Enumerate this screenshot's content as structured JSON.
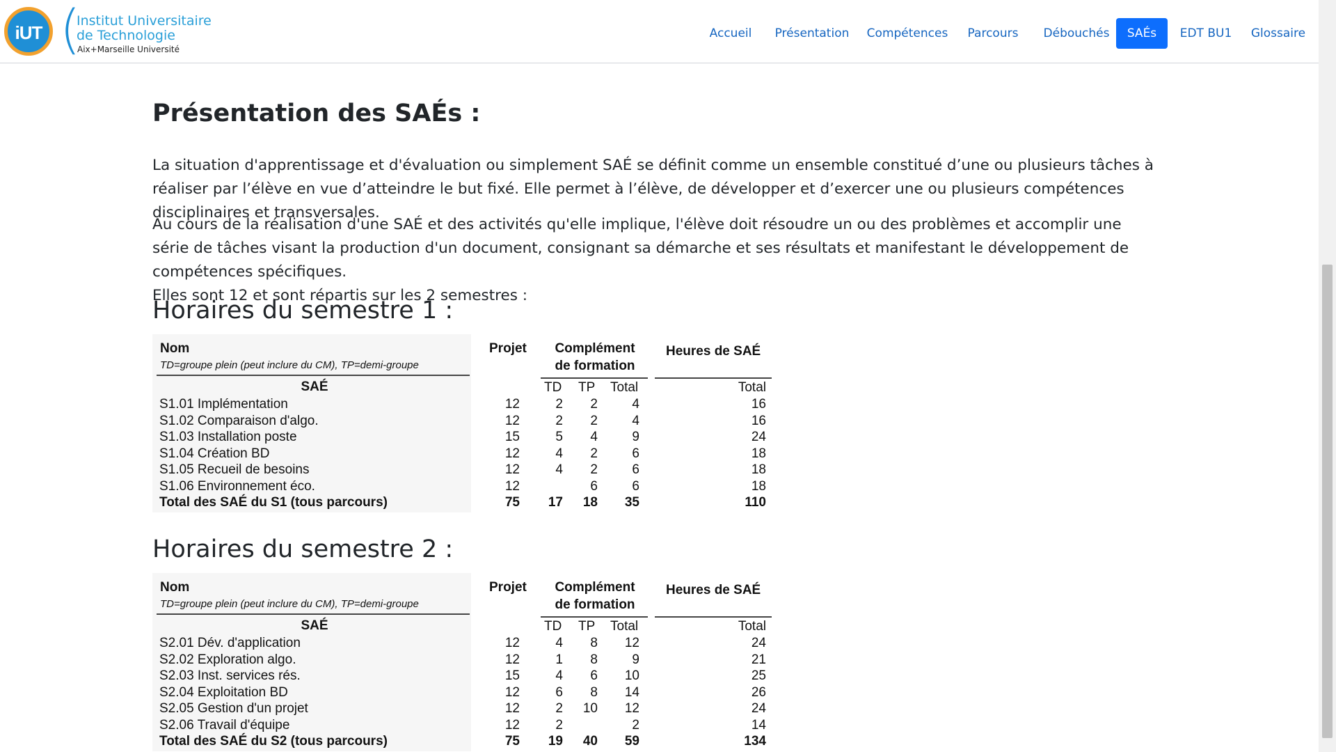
{
  "logo": {
    "badge": "iUT",
    "line1": "Institut Universitaire",
    "line2": "de Technologie",
    "line3": "Aix+Marseille Université"
  },
  "nav": {
    "items": [
      {
        "label": "Accueil"
      },
      {
        "label": "Présentation"
      },
      {
        "label": "Compétences"
      },
      {
        "label": "Parcours"
      },
      {
        "label": "Débouchés"
      },
      {
        "label": "SAÉs"
      },
      {
        "label": "EDT BU1"
      },
      {
        "label": "Glossaire"
      }
    ],
    "active": "SAÉs"
  },
  "content": {
    "title": "Présentation des SAÉs :",
    "paragraph1": "La situation d'apprentissage et d'évaluation ou simplement SAÉ se définit comme un ensemble constitué d’une ou plusieurs tâches à réaliser par l’élève en vue d’atteindre le but fixé. Elle permet à l’élève, de développer et d’exercer une ou plusieurs compétences disciplinaires et transversales.",
    "paragraph2_line1": "Au cours de la réalisation d'une SAÉ et des activités qu'elle implique, l'élève doit résoudre un ou des problèmes et accomplir une série de tâches visant la production d'un document, consignant sa démarche et ses résultats et manifestant le développement de compétences spécifiques.",
    "paragraph2_line2": "Elles sont 12 et sont répartis sur les 2 semestres :"
  },
  "semesters": [
    {
      "heading": "Horaires du semestre 1 :",
      "headers": {
        "nom": "Nom",
        "sub": "TD=groupe plein (peut inclure du CM), TP=demi-groupe",
        "projet": "Projet",
        "comp1": "Complément",
        "comp2": "de formation",
        "heures": "Heures de SAÉ",
        "sae": "SAÉ",
        "td": "TD",
        "tp": "TP",
        "total": "Total",
        "total2": "Total"
      },
      "rows": [
        {
          "name": "S1.01 Implémentation",
          "projet": "12",
          "td": "2",
          "tp": "2",
          "total": "4",
          "heures": "16"
        },
        {
          "name": "S1.02 Comparaison d'algo.",
          "projet": "12",
          "td": "2",
          "tp": "2",
          "total": "4",
          "heures": "16"
        },
        {
          "name": "S1.03 Installation poste",
          "projet": "15",
          "td": "5",
          "tp": "4",
          "total": "9",
          "heures": "24"
        },
        {
          "name": "S1.04 Création BD",
          "projet": "12",
          "td": "4",
          "tp": "2",
          "total": "6",
          "heures": "18"
        },
        {
          "name": "S1.05 Recueil de besoins",
          "projet": "12",
          "td": "4",
          "tp": "2",
          "total": "6",
          "heures": "18"
        },
        {
          "name": "S1.06 Environnement éco.",
          "projet": "12",
          "td": "",
          "tp": "6",
          "total": "6",
          "heures": "18"
        }
      ],
      "total_row": {
        "name": "Total des SAÉ du S1 (tous parcours)",
        "projet": "75",
        "td": "17",
        "tp": "18",
        "total": "35",
        "heures": "110"
      }
    },
    {
      "heading": "Horaires du semestre 2 :",
      "headers": {
        "nom": "Nom",
        "sub": "TD=groupe plein (peut inclure du CM), TP=demi-groupe",
        "projet": "Projet",
        "comp1": "Complément",
        "comp2": "de formation",
        "heures": "Heures de SAÉ",
        "sae": "SAÉ",
        "td": "TD",
        "tp": "TP",
        "total": "Total",
        "total2": "Total"
      },
      "rows": [
        {
          "name": "S2.01 Dév. d'application",
          "projet": "12",
          "td": "4",
          "tp": "8",
          "total": "12",
          "heures": "24"
        },
        {
          "name": "S2.02 Exploration algo.",
          "projet": "12",
          "td": "1",
          "tp": "8",
          "total": "9",
          "heures": "21"
        },
        {
          "name": "S2.03 Inst. services rés.",
          "projet": "15",
          "td": "4",
          "tp": "6",
          "total": "10",
          "heures": "25"
        },
        {
          "name": "S2.04 Exploitation BD",
          "projet": "12",
          "td": "6",
          "tp": "8",
          "total": "14",
          "heures": "26"
        },
        {
          "name": "S2.05 Gestion d'un projet",
          "projet": "12",
          "td": "2",
          "tp": "10",
          "total": "12",
          "heures": "24"
        },
        {
          "name": "S2.06 Travail d'équipe",
          "projet": "12",
          "td": "2",
          "tp": "",
          "total": "2",
          "heures": "14"
        }
      ],
      "total_row": {
        "name": "Total des SAÉ du S2 (tous parcours)",
        "projet": "75",
        "td": "19",
        "tp": "40",
        "total": "59",
        "heures": "134"
      }
    }
  ]
}
